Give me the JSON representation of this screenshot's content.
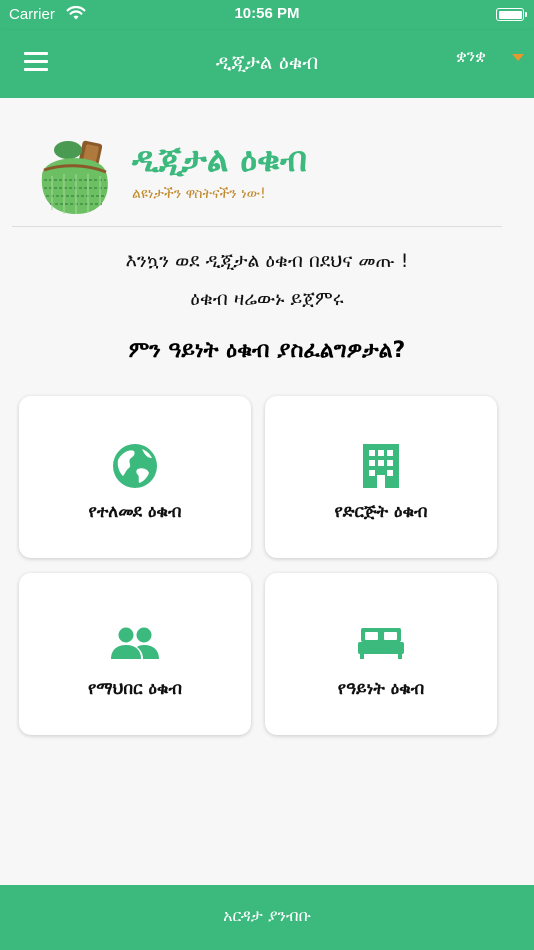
{
  "status_bar": {
    "carrier": "Carrier",
    "time": "10:56 PM"
  },
  "app_bar": {
    "title": "ዲጂታል ዕቁብ",
    "language": "ቋንቋ"
  },
  "brand": {
    "title": "ዲጂታል ዕቁብ",
    "tagline": "ልዩነታችን ዋስትናችን ነው!"
  },
  "welcome_text": "እንኳን ወደ ዲጂታል ዕቁብ በደህና መጡ !",
  "start_text": "ዕቁብ ዛሬውኑ ይጀምሩ",
  "question": "ምን ዓይነት ዕቁብ ያስፈልግዎታል?",
  "categories": [
    {
      "label": "የተለመደ ዕቁብ",
      "icon": "globe-icon"
    },
    {
      "label": "የድርጅት ዕቁብ",
      "icon": "building-icon"
    },
    {
      "label": "የማህበር ዕቁብ",
      "icon": "group-icon"
    },
    {
      "label": "የዓይነት ዕቁብ",
      "icon": "bed-icon"
    }
  ],
  "bottom_bar": {
    "label": "አርዳታ ያንብቡ"
  },
  "colors": {
    "primary": "#3cb97d",
    "accent": "#c28a2e",
    "caret": "#e8962e",
    "background": "#f7f7f7"
  }
}
